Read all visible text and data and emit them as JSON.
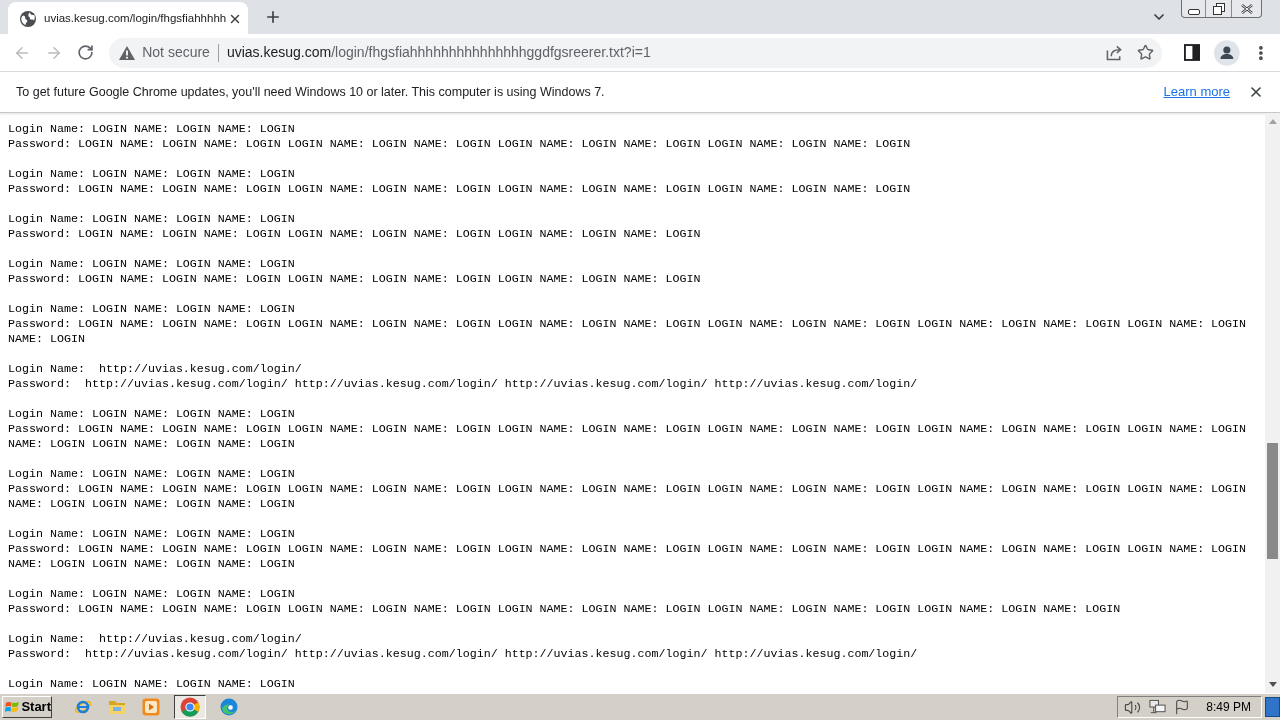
{
  "tab_strip": {
    "tabs": [
      {
        "title": "uvias.kesug.com/login/fhgsfiahhhhh",
        "selected": true
      }
    ]
  },
  "toolbar": {
    "back": {
      "disabled": true
    },
    "forward": {
      "disabled": true
    },
    "address_bar": {
      "security": "Not secure",
      "host": "uvias.kesug.com",
      "path": "/login/fhgsfiahhhhhhhhhhhhhhhggdfgsreerer.txt?i=1",
      "bookmarked": false
    }
  },
  "infobar": {
    "message": "To get future Google Chrome updates, you'll need Windows 10 or later. This computer is using Windows 7.",
    "link": "Learn more"
  },
  "document": {
    "records": [
      {
        "login": "Login Name: LOGIN NAME: LOGIN NAME: LOGIN",
        "password": "Password: LOGIN NAME: LOGIN NAME: LOGIN LOGIN NAME: LOGIN NAME: LOGIN LOGIN NAME: LOGIN NAME: LOGIN LOGIN NAME: LOGIN NAME: LOGIN"
      },
      {
        "login": "Login Name: LOGIN NAME: LOGIN NAME: LOGIN",
        "password": "Password: LOGIN NAME: LOGIN NAME: LOGIN LOGIN NAME: LOGIN NAME: LOGIN LOGIN NAME: LOGIN NAME: LOGIN LOGIN NAME: LOGIN NAME: LOGIN"
      },
      {
        "login": "Login Name: LOGIN NAME: LOGIN NAME: LOGIN",
        "password": "Password: LOGIN NAME: LOGIN NAME: LOGIN LOGIN NAME: LOGIN NAME: LOGIN LOGIN NAME: LOGIN NAME: LOGIN"
      },
      {
        "login": "Login Name: LOGIN NAME: LOGIN NAME: LOGIN",
        "password": "Password: LOGIN NAME: LOGIN NAME: LOGIN LOGIN NAME: LOGIN NAME: LOGIN LOGIN NAME: LOGIN NAME: LOGIN"
      },
      {
        "login": "Login Name: LOGIN NAME: LOGIN NAME: LOGIN",
        "password": "Password: LOGIN NAME: LOGIN NAME: LOGIN LOGIN NAME: LOGIN NAME: LOGIN LOGIN NAME: LOGIN NAME: LOGIN LOGIN NAME: LOGIN NAME: LOGIN LOGIN NAME: LOGIN NAME: LOGIN LOGIN NAME: LOGIN NAME: LOGIN"
      },
      {
        "login": "Login Name:  http://uvias.kesug.com/login/",
        "password": "Password:  http://uvias.kesug.com/login/ http://uvias.kesug.com/login/ http://uvias.kesug.com/login/ http://uvias.kesug.com/login/"
      },
      {
        "login": "Login Name: LOGIN NAME: LOGIN NAME: LOGIN",
        "password": "Password: LOGIN NAME: LOGIN NAME: LOGIN LOGIN NAME: LOGIN NAME: LOGIN LOGIN NAME: LOGIN NAME: LOGIN LOGIN NAME: LOGIN NAME: LOGIN LOGIN NAME: LOGIN NAME: LOGIN LOGIN NAME: LOGIN NAME: LOGIN LOGIN NAME: LOGIN NAME: LOGIN"
      },
      {
        "login": "Login Name: LOGIN NAME: LOGIN NAME: LOGIN",
        "password": "Password: LOGIN NAME: LOGIN NAME: LOGIN LOGIN NAME: LOGIN NAME: LOGIN LOGIN NAME: LOGIN NAME: LOGIN LOGIN NAME: LOGIN NAME: LOGIN LOGIN NAME: LOGIN NAME: LOGIN LOGIN NAME: LOGIN NAME: LOGIN LOGIN NAME: LOGIN NAME: LOGIN"
      },
      {
        "login": "Login Name: LOGIN NAME: LOGIN NAME: LOGIN",
        "password": "Password: LOGIN NAME: LOGIN NAME: LOGIN LOGIN NAME: LOGIN NAME: LOGIN LOGIN NAME: LOGIN NAME: LOGIN LOGIN NAME: LOGIN NAME: LOGIN LOGIN NAME: LOGIN NAME: LOGIN LOGIN NAME: LOGIN NAME: LOGIN LOGIN NAME: LOGIN NAME: LOGIN"
      },
      {
        "login": "Login Name: LOGIN NAME: LOGIN NAME: LOGIN",
        "password": "Password: LOGIN NAME: LOGIN NAME: LOGIN LOGIN NAME: LOGIN NAME: LOGIN LOGIN NAME: LOGIN NAME: LOGIN LOGIN NAME: LOGIN NAME: LOGIN LOGIN NAME: LOGIN NAME: LOGIN"
      },
      {
        "login": "Login Name:  http://uvias.kesug.com/login/",
        "password": "Password:  http://uvias.kesug.com/login/ http://uvias.kesug.com/login/ http://uvias.kesug.com/login/ http://uvias.kesug.com/login/"
      },
      {
        "login": "Login Name: LOGIN NAME: LOGIN NAME: LOGIN"
      }
    ]
  },
  "taskbar": {
    "start": "Start",
    "apps": [
      {
        "kind": "internet-explorer",
        "selected": false
      },
      {
        "kind": "folder",
        "selected": false
      },
      {
        "kind": "media-player",
        "selected": false
      },
      {
        "kind": "chrome",
        "selected": true
      },
      {
        "kind": "edge",
        "selected": false
      }
    ],
    "clock": "8:49 PM"
  }
}
